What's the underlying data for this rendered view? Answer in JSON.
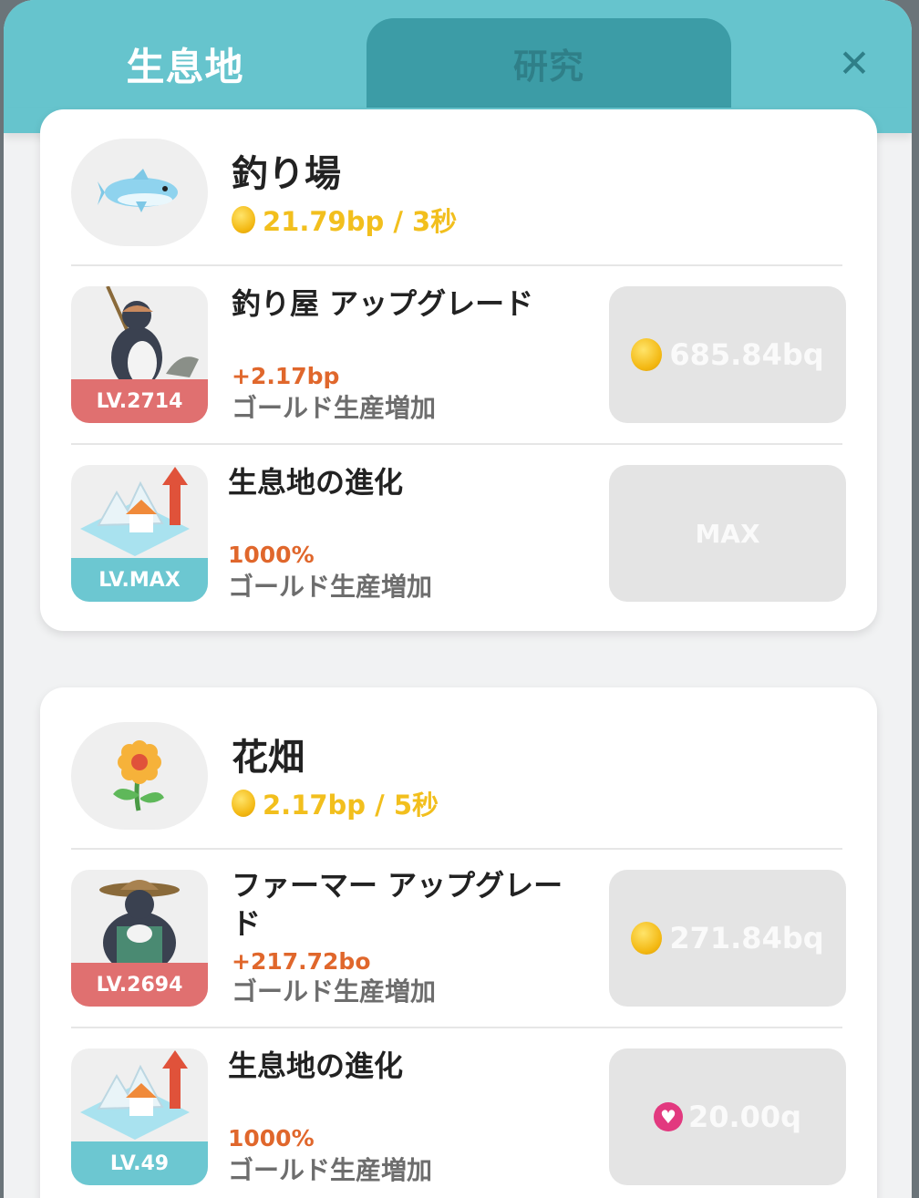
{
  "tabs": {
    "active": "生息地",
    "inactive": "研究",
    "close": "✕"
  },
  "habitats": [
    {
      "name": "釣り場",
      "icon": "fish-icon",
      "rate": "21.79bp / 3秒",
      "upgrades": [
        {
          "name": "釣り屋 アップグレード",
          "bonus": "+2.17bp",
          "desc": "ゴールド生産増加",
          "level": "LV.2714",
          "badge_color": "#e07070",
          "price": "685.84bq",
          "currency": "gold",
          "icon": "fisher-penguin-icon"
        },
        {
          "name": "生息地の進化",
          "bonus": "1000%",
          "desc": "ゴールド生産増加",
          "level": "LV.MAX",
          "badge_color": "#6cc7d1",
          "price": "MAX",
          "currency": "none",
          "icon": "habitat-evolution-icon"
        }
      ]
    },
    {
      "name": "花畑",
      "icon": "flower-icon",
      "rate": "2.17bp / 5秒",
      "upgrades": [
        {
          "name": "ファーマー アップグレード",
          "bonus": "+217.72bo",
          "desc": "ゴールド生産増加",
          "level": "LV.2694",
          "badge_color": "#e07070",
          "price": "271.84bq",
          "currency": "gold",
          "icon": "farmer-penguin-icon"
        },
        {
          "name": "生息地の進化",
          "bonus": "1000%",
          "desc": "ゴールド生産増加",
          "level": "LV.49",
          "badge_color": "#6cc7d1",
          "price": "20.00q",
          "currency": "heart",
          "icon": "habitat-evolution-icon"
        }
      ]
    }
  ],
  "colors": {
    "header": "#66c4cd",
    "tab_inactive": "#3c9ca6",
    "gold": "#f2bf1d",
    "bonus": "#e0672c",
    "level_red": "#e07070",
    "level_blue": "#6cc7d1",
    "heart": "#e2397f"
  }
}
